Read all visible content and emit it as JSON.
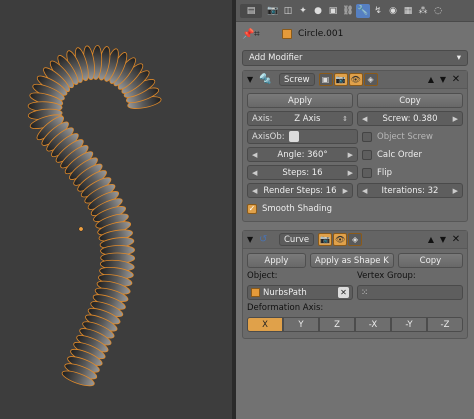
{
  "header": {
    "context_icons": [
      "view-icon",
      "render-icon",
      "layers-icon",
      "scene-icon",
      "world-icon",
      "object-icon",
      "constraint-icon",
      "modifier-icon",
      "data-icon",
      "material-icon",
      "texture-icon",
      "particles-icon",
      "physics-icon"
    ],
    "active_tab": "modifier"
  },
  "object_row": {
    "name": "Circle.001"
  },
  "add_modifier": {
    "label": "Add Modifier"
  },
  "screw": {
    "name": "Screw",
    "apply_label": "Apply",
    "copy_label": "Copy",
    "axis_label": "Axis:",
    "axis_value": "Z Axis",
    "screw_label": "Screw:",
    "screw_value": "0.380",
    "axisob_label": "AxisOb:",
    "object_screw_label": "Object Screw",
    "angle_label": "Angle:",
    "angle_value": "360°",
    "calc_order_label": "Calc Order",
    "steps_label": "Steps:",
    "steps_value": "16",
    "flip_label": "Flip",
    "render_steps_label": "Render Steps:",
    "render_steps_value": "16",
    "iterations_label": "Iterations:",
    "iterations_value": "32",
    "smooth_shading_label": "Smooth Shading",
    "smooth_shading": true
  },
  "curve": {
    "name": "Curve",
    "apply_label": "Apply",
    "apply_shape_label": "Apply as Shape K",
    "copy_label": "Copy",
    "object_label": "Object:",
    "vertex_group_label": "Vertex Group:",
    "object_value": "NurbsPath",
    "deformation_axis_label": "Deformation Axis:",
    "axes": [
      "X",
      "Y",
      "Z",
      "-X",
      "-Y",
      "-Z"
    ],
    "selected_axis": "X"
  },
  "colors": {
    "accent": "#e0a14a",
    "active_tab": "#5680c2",
    "panel_bg": "#727272",
    "viewport_bg": "#3d3d3d"
  }
}
